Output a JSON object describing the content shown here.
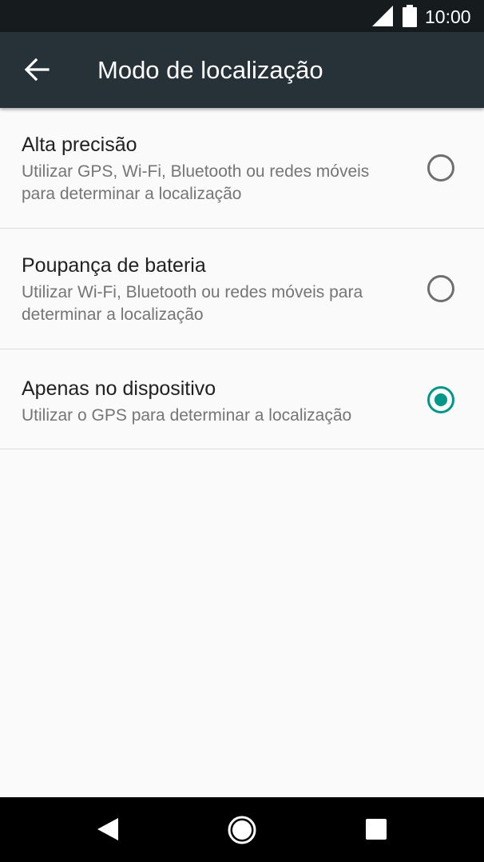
{
  "status_bar": {
    "time": "10:00",
    "icons": [
      "cell-signal-icon",
      "battery-icon"
    ]
  },
  "app_bar": {
    "back_icon": "arrow-left-icon",
    "title": "Modo de localização"
  },
  "options": [
    {
      "title": "Alta precisão",
      "description": "Utilizar GPS, Wi-Fi, Bluetooth ou redes móveis para determinar a localização",
      "selected": false
    },
    {
      "title": "Poupança de bateria",
      "description": "Utilizar Wi-Fi, Bluetooth ou redes móveis para determinar a localização",
      "selected": false
    },
    {
      "title": "Apenas no dispositivo",
      "description": "Utilizar o GPS para determinar a localização",
      "selected": true
    }
  ],
  "colors": {
    "status_bar": "#161c1e",
    "app_bar": "#263238",
    "accent": "#009688",
    "background": "#fafafa"
  },
  "nav_bar": {
    "icons": [
      "back-triangle-icon",
      "home-circle-icon",
      "recents-square-icon"
    ]
  }
}
